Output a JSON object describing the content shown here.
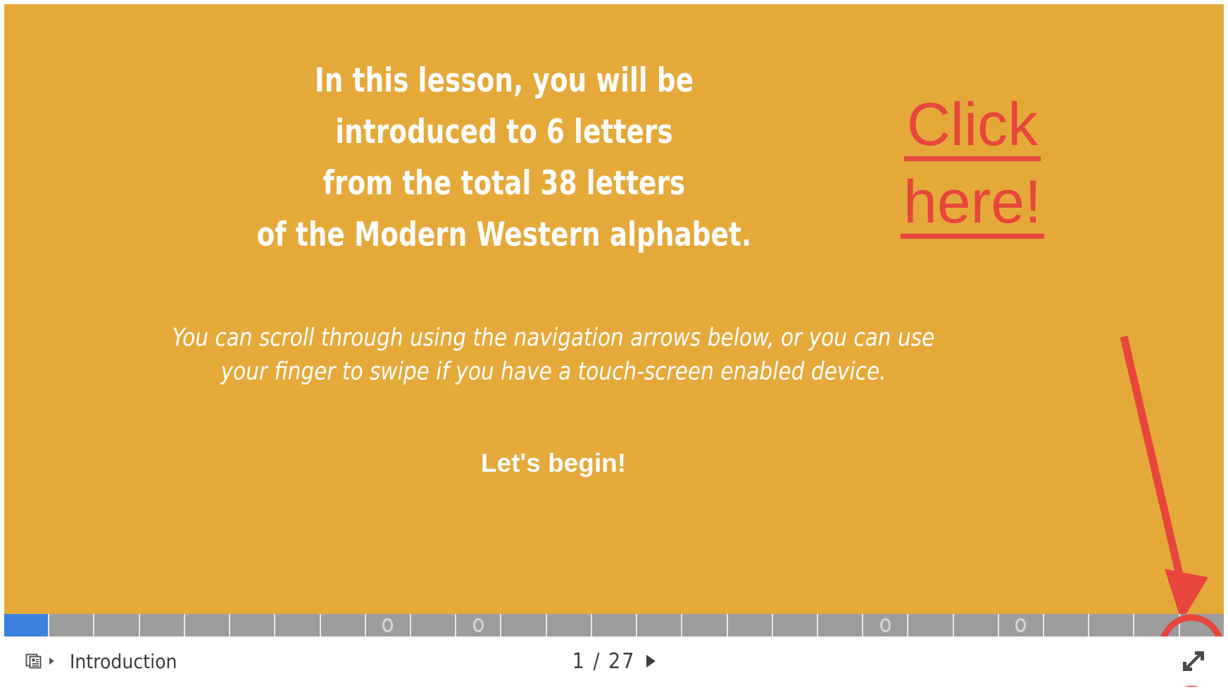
{
  "slide": {
    "background_color": "#E5A93A",
    "headline": {
      "lines": [
        "In this lesson, you will be",
        "introduced to 6 letters",
        "from the total 38 letters",
        "of the Modern Western alphabet."
      ],
      "color": "#FFFFFF"
    },
    "paragraph": {
      "lines": [
        "You can scroll through using the navigation arrows below, or you can use",
        "your finger to swipe if you have a touch-screen enabled device."
      ],
      "color": "#FFFFFF"
    },
    "cta_text": "Let's begin!",
    "annotation": {
      "line1": "Click",
      "line2": "here!",
      "color": "#E8453C",
      "arrow_name": "red-pointer-arrow",
      "ring_name": "red-highlight-ring"
    }
  },
  "progress": {
    "total_segments": 27,
    "completed_segments": 1,
    "completed_color": "#3B82E0",
    "track_color": "#9D9D9D",
    "bullet_segments": [
      9,
      11,
      20,
      23
    ]
  },
  "toolbar": {
    "slides_icon": "slides-panel-icon",
    "expand_caret_icon": "chevron-right-icon",
    "section_label": "Introduction",
    "current_page": "1",
    "separator": "/",
    "total_pages": "27",
    "page_counter": "1 / 27",
    "next_icon": "play-triangle-icon",
    "fullscreen_icon": "fullscreen-expand-icon"
  }
}
